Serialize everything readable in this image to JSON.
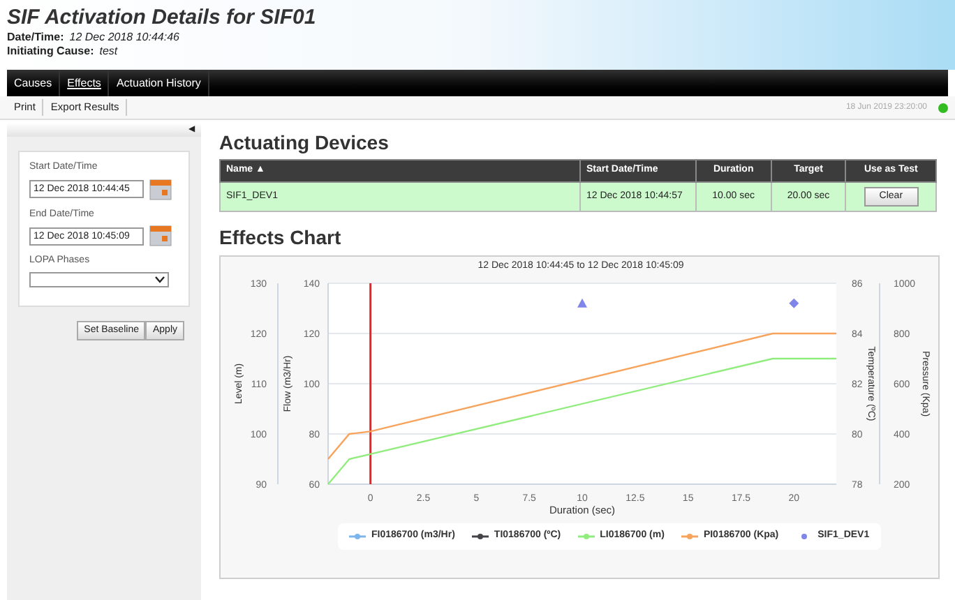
{
  "header": {
    "title": "SIF Activation Details for SIF01",
    "details": [
      {
        "label": "Date/Time:",
        "value": "12 Dec 2018 10:44:46"
      },
      {
        "label": "Initiating Cause:",
        "value": "test"
      }
    ]
  },
  "tabs": [
    {
      "label": "Causes",
      "selected": false
    },
    {
      "label": "Effects",
      "selected": true
    },
    {
      "label": "Actuation History",
      "selected": false
    }
  ],
  "toolbar": {
    "buttons": [
      "Print",
      "Export Results"
    ],
    "timestamp": "18 Jun 2019 23:20:00"
  },
  "sidebar": {
    "collapse_glyph": "◀",
    "fields": [
      {
        "kind": "date",
        "label": "Start Date/Time",
        "value": "12 Dec 2018 10:44:45"
      },
      {
        "kind": "date",
        "label": "End Date/Time",
        "value": "12 Dec 2018 10:45:09"
      },
      {
        "kind": "select",
        "label": "LOPA Phases"
      }
    ],
    "buttons": [
      "Set Baseline",
      "Apply"
    ]
  },
  "devices": {
    "title": "Actuating Devices",
    "columns": [
      "Name ▲",
      "Start Date/Time",
      "Duration",
      "Target",
      "Use as Test"
    ],
    "rows": [
      {
        "cells": [
          "SIF1_DEV1",
          "12 Dec 2018 10:44:57",
          "10.00 sec",
          "20.00 sec"
        ],
        "button": "Clear"
      }
    ]
  },
  "effects": {
    "title": "Effects Chart",
    "temperature_axis": {
      "label": "Temperature (ºC)",
      "ticks": [
        "86",
        "84",
        "82",
        "80",
        "78"
      ]
    },
    "chart_data": {
      "type": "line",
      "title": "12 Dec 2018 10:44:45 to 12 Dec 2018 10:45:09",
      "xlabel": "Duration (sec)",
      "ylabel": "Flow (m3/Hr)",
      "xlim": [
        -2,
        22
      ],
      "ylim": [
        60,
        140
      ],
      "xticks": [
        0,
        2.5,
        5,
        7.5,
        10,
        12.5,
        15,
        17.5,
        20
      ],
      "yticks": [
        60,
        80,
        100,
        120,
        140
      ],
      "y2label": "Pressure (Kpa)",
      "y2lim": [
        200,
        1000
      ],
      "y2ticks": [
        200,
        400,
        600,
        800,
        1000
      ],
      "y3label": "Level (m)",
      "y3lim": [
        90,
        130
      ],
      "y3ticks": [
        90,
        100,
        110,
        120,
        130
      ],
      "x": [
        -2,
        -1,
        0,
        19,
        22
      ],
      "series": [
        {
          "name": "FI0186700 (m3/Hr)",
          "color": "#7cb5ec",
          "values": [
            null,
            null,
            null,
            null,
            null
          ]
        },
        {
          "name": "TI0186700 (ºC)",
          "color": "#434348",
          "values": [
            null,
            null,
            null,
            null,
            null
          ]
        },
        {
          "name": "LI0186700 (m)",
          "color": "#90ed7d",
          "axis": "y3",
          "values": [
            90,
            95,
            96,
            115,
            115
          ]
        },
        {
          "name": "PI0186700 (Kpa)",
          "color": "#f7a35c",
          "axis": "y2",
          "values": [
            300,
            400,
            410,
            800,
            800
          ]
        },
        {
          "name": "SIF1_DEV1",
          "color": "#8085e9",
          "type": "scatter",
          "x": [
            10,
            20
          ],
          "values": [
            132,
            132
          ]
        }
      ],
      "ref_lines": [
        {
          "axis": "x",
          "value": 0,
          "color": "#ee2222"
        }
      ],
      "grid": true,
      "legend": "bottom"
    }
  }
}
